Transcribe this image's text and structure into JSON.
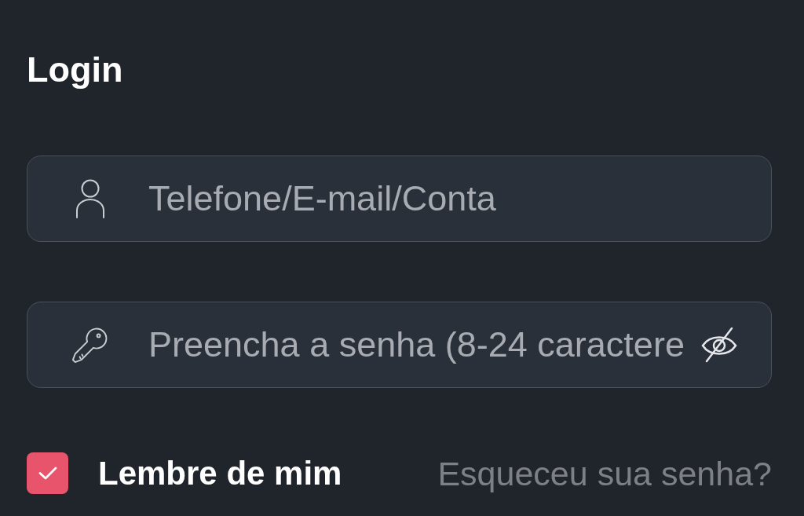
{
  "title": "Login",
  "fields": [
    {
      "kind": "account",
      "placeholder": "Telefone/E-mail/Conta"
    },
    {
      "kind": "password",
      "placeholder": "Preencha a senha (8-24 caractere",
      "password_visible": false
    }
  ],
  "remember": {
    "label": "Lembre de mim",
    "checked": true
  },
  "forgot_link": "Esqueceu sua senha?"
}
